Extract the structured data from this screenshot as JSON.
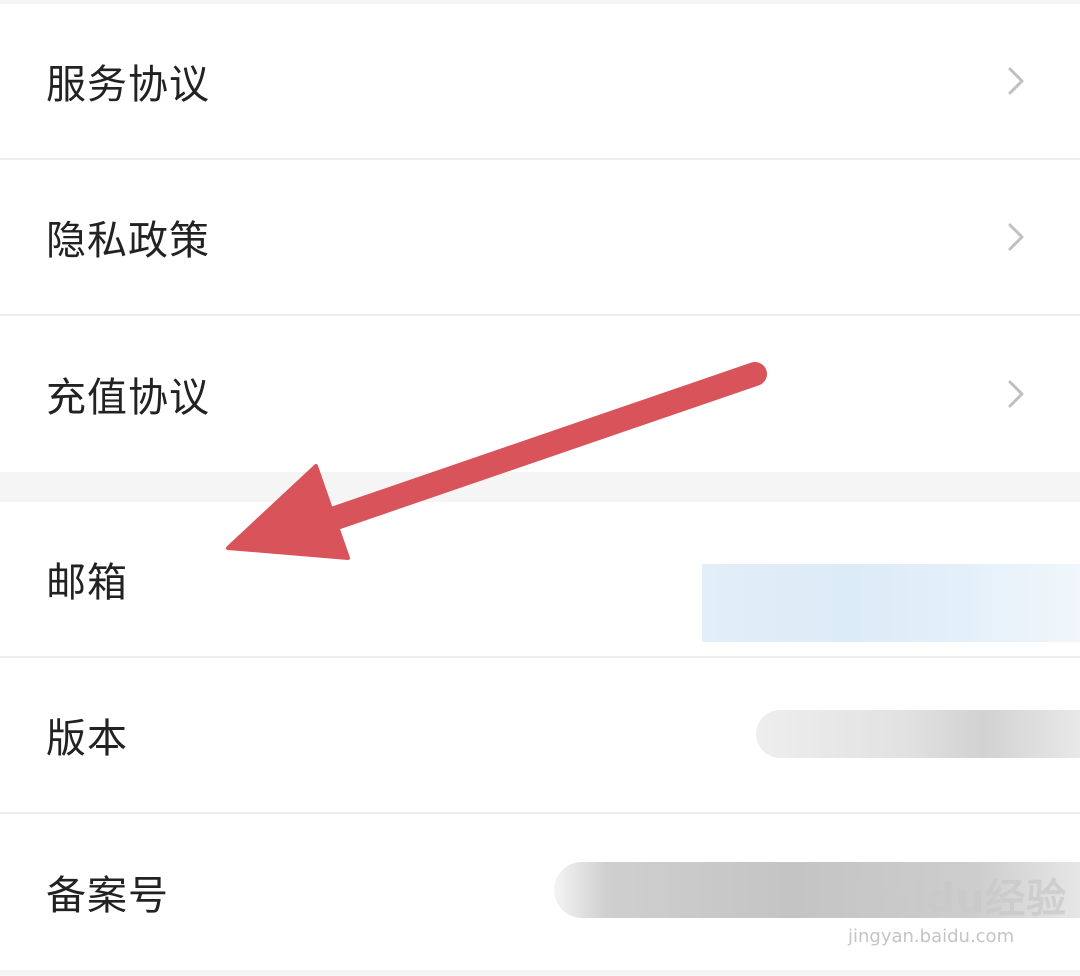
{
  "menu_top": {
    "items": [
      {
        "label": "服务协议"
      },
      {
        "label": "隐私政策"
      },
      {
        "label": "充值协议"
      }
    ]
  },
  "info": {
    "email_label": "邮箱",
    "version_label": "版本",
    "record_label": "备案号"
  },
  "watermark": {
    "logo_text": "Baidu经验",
    "url": "jingyan.baidu.com"
  },
  "colors": {
    "arrow": "#d9535a",
    "chevron": "#c0c0c0",
    "divider": "#eeeeee",
    "text": "#222222"
  },
  "icons": {
    "chevron": "chevron-right-icon",
    "annotation": "annotation-arrow"
  }
}
